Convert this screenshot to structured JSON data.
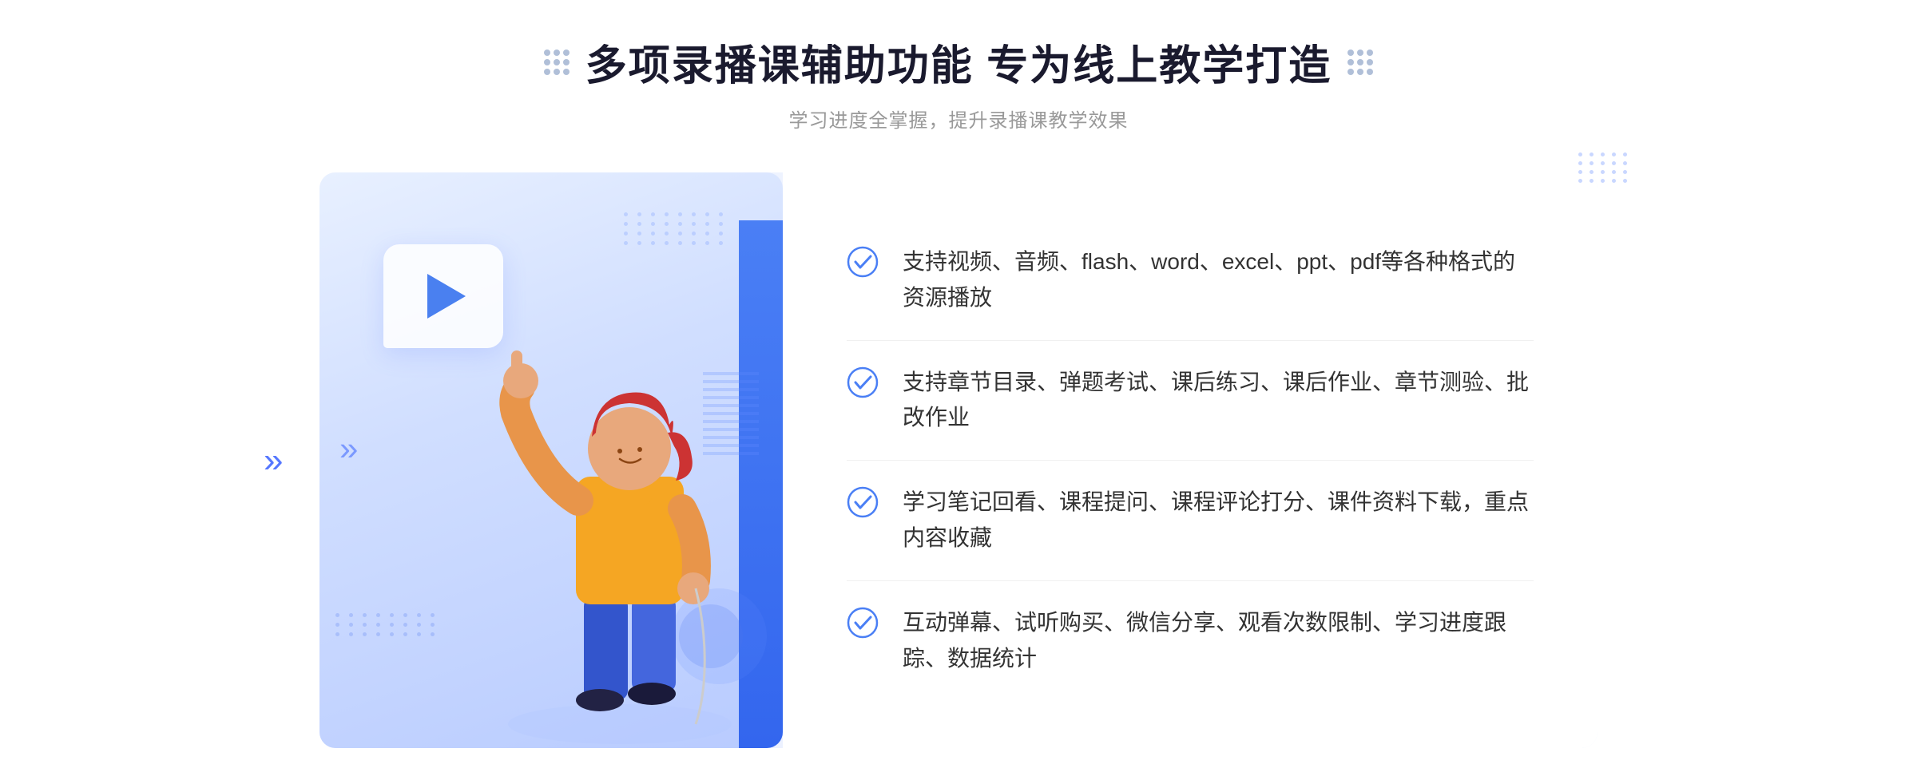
{
  "header": {
    "title": "多项录播课辅助功能 专为线上教学打造",
    "subtitle": "学习进度全掌握，提升录播课教学效果",
    "title_deco_left": "⁚",
    "title_deco_right": "⁚"
  },
  "features": [
    {
      "id": 1,
      "text": "支持视频、音频、flash、word、excel、ppt、pdf等各种格式的资源播放"
    },
    {
      "id": 2,
      "text": "支持章节目录、弹题考试、课后练习、课后作业、章节测验、批改作业"
    },
    {
      "id": 3,
      "text": "学习笔记回看、课程提问、课程评论打分、课件资料下载，重点内容收藏"
    },
    {
      "id": 4,
      "text": "互动弹幕、试听购买、微信分享、观看次数限制、学习进度跟踪、数据统计"
    }
  ],
  "colors": {
    "primary_blue": "#4a7ff5",
    "light_blue": "#e8efff",
    "text_dark": "#333333",
    "text_gray": "#999999",
    "check_color": "#4a7ff5",
    "title_color": "#1a1a2e"
  },
  "chevron_left": "»",
  "play_button_label": "播放"
}
